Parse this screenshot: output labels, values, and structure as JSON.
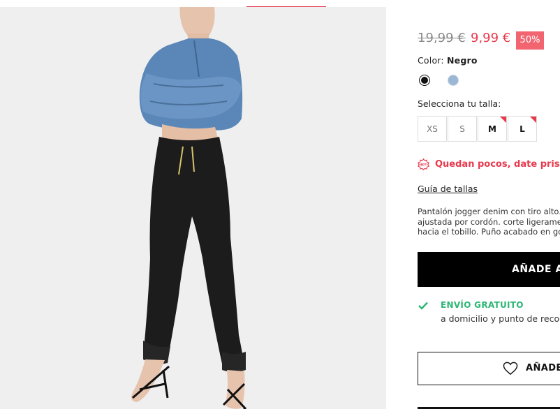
{
  "product": {
    "old_price": "19,99 €",
    "new_price": "9,99 €",
    "discount": "50%",
    "color_prefix": "Color:",
    "color_name": "Negro",
    "swatches": [
      {
        "name": "Negro",
        "color": "#111111",
        "selected": true
      },
      {
        "name": "Azul",
        "color": "#9bb7d4",
        "selected": false
      }
    ],
    "size_label": "Selecciona tu talla:",
    "sizes": [
      {
        "label": "XS",
        "available": false,
        "low_stock": false
      },
      {
        "label": "S",
        "available": false,
        "low_stock": false
      },
      {
        "label": "M",
        "available": true,
        "low_stock": true
      },
      {
        "label": "L",
        "available": true,
        "low_stock": true
      }
    ],
    "hurry_text": "Quedan pocos, date prisa",
    "hurry_icon_text": "HEY!",
    "size_guide": "Guía de tallas",
    "description_lines": [
      "Pantalón jogger denim con tiro alto. Cintura",
      "ajustada por cordón. corte ligeramente",
      "hacia el tobillo. Puño acabado en goma."
    ],
    "add_to_cart": "AÑADE A LA CESTA",
    "shipping_title": "ENVÍO GRATUITO",
    "shipping_sub": "a domicilio y punto de recogida",
    "wishlist": "AÑADE A FAVORITOS"
  },
  "colors": {
    "accent": "#e8394d",
    "discount_bg": "#f16470",
    "shipping_green": "#2bb673"
  }
}
